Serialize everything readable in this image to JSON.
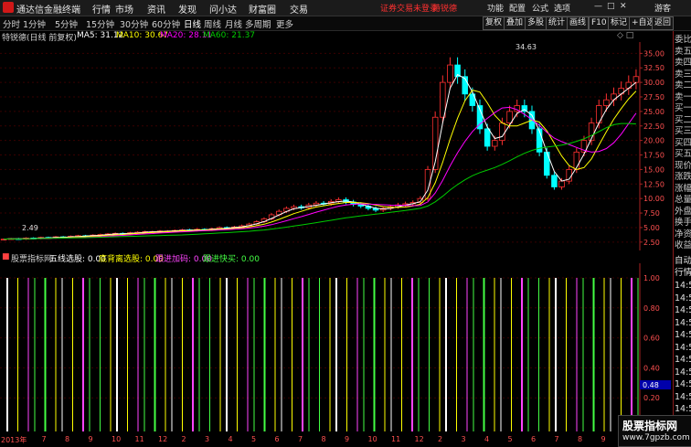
{
  "app": {
    "title": "通达信金融终端",
    "brand_color": "#d01818"
  },
  "menu": [
    "行情",
    "市场",
    "资讯",
    "发现",
    "问小达",
    "财富圈",
    "交易"
  ],
  "notice": {
    "text": "证券交易未登录",
    "stock": "特锐德"
  },
  "right_menu": [
    "功能",
    "配置",
    "公式",
    "选项",
    "游客"
  ],
  "periods": [
    "分时",
    "1分钟",
    "5分钟",
    "15分钟",
    "30分钟",
    "60分钟",
    "日线",
    "周线",
    "月线",
    "多周期",
    "更多"
  ],
  "active_period": "日线",
  "tool_buttons": [
    "复权",
    "叠加",
    "多股",
    "统计",
    "画线",
    "F10",
    "标记",
    "+自选",
    "返回"
  ],
  "legend": {
    "stock": "特锐德(日线 前复权)",
    "ma5": "MA5: 31.12",
    "ma10": "MA10: 30.67",
    "ma20": "MA20: 28.11",
    "ma60": "MA60: 21.37",
    "colors": {
      "ma5": "#ffffff",
      "ma10": "#ffff00",
      "ma20": "#ff00ff",
      "ma60": "#00cc00"
    }
  },
  "price_axis": [
    "35.00",
    "32.50",
    "30.00",
    "27.50",
    "25.00",
    "22.50",
    "20.00",
    "17.50",
    "15.00",
    "12.50",
    "10.00",
    "7.50",
    "5.00",
    "2.50"
  ],
  "annotations": {
    "high": "34.63",
    "low": "2.49"
  },
  "sub_header": {
    "site": "股票指标网",
    "s1": "五线选股: 0.00",
    "s2": "底背离选股: 0.00",
    "s3": "跟进加码: 0.00",
    "s4": "跟进快买: 0.00",
    "colors": {
      "s1": "#ffffff",
      "s2": "#ffff00",
      "s3": "#ff44ff",
      "s4": "#44ff44"
    }
  },
  "sub_axis": [
    "1.00",
    "0.80",
    "0.60",
    "0.40",
    "0.20"
  ],
  "sub_value": "0.48",
  "x_axis": [
    "2013年",
    "7",
    "8",
    "9",
    "10",
    "11",
    "12",
    "2",
    "3",
    "4",
    "5",
    "6",
    "7",
    "8",
    "9",
    "10",
    "11",
    "12",
    "2",
    "3",
    "4",
    "5",
    "6",
    "7",
    "8",
    "9",
    "10",
    "11"
  ],
  "right_panel": {
    "labels": [
      "委比",
      "卖五",
      "卖四",
      "卖三",
      "卖二",
      "卖一",
      "买一",
      "买二",
      "买三",
      "买四",
      "买五",
      "现价",
      "涨跌",
      "涨幅",
      "总量",
      "外盘",
      "换手",
      "净资",
      "收益"
    ],
    "lower": [
      "自动",
      "行情"
    ],
    "times": [
      "14:5",
      "14:5",
      "14:5",
      "14:5",
      "14:5",
      "14:5",
      "14:5",
      "14:5",
      "14:5",
      "14:5",
      "14:5"
    ],
    "top_value": "300"
  },
  "watermark": {
    "line1": "股票指标网",
    "line2": "www.7gpzb.com"
  },
  "window_buttons": [
    "—",
    "□",
    "✕"
  ],
  "chart_data": {
    "type": "candlestick",
    "price_range": [
      2.0,
      36.0
    ],
    "close_series": [
      3.0,
      3.1,
      3.0,
      3.2,
      3.1,
      3.3,
      3.2,
      3.4,
      3.3,
      3.5,
      3.6,
      3.5,
      3.7,
      3.8,
      3.9,
      4.0,
      3.9,
      4.1,
      4.2,
      4.3,
      4.3,
      4.4,
      4.4,
      4.5,
      4.6,
      4.5,
      4.7,
      4.6,
      4.8,
      5.0,
      4.9,
      5.1,
      5.3,
      5.6,
      6.0,
      6.5,
      7.2,
      7.8,
      8.3,
      8.6,
      8.4,
      8.9,
      9.2,
      9.1,
      9.5,
      9.8,
      9.4,
      9.0,
      8.7,
      8.3,
      8.0,
      8.3,
      8.6,
      8.9,
      9.1,
      9.3,
      10.0,
      15.0,
      24.0,
      30.0,
      33.0,
      31.0,
      28.0,
      26.0,
      22.0,
      19.0,
      20.0,
      23.0,
      25.0,
      26.0,
      25.0,
      22.0,
      18.0,
      14.0,
      12.0,
      13.0,
      15.0,
      18.0,
      20.0,
      23.0,
      26.0,
      27.0,
      28.0,
      29.0,
      30.0,
      31.0
    ],
    "subchart_bars": {
      "colors": {
        "s1": "#ffffff",
        "s2": "#ffff00",
        "s3": "#ff44ff",
        "s4": "#44ff44"
      },
      "values": [
        1,
        1,
        1,
        1,
        1,
        1,
        1,
        1,
        1,
        1,
        1,
        1,
        1,
        1,
        1,
        1,
        1,
        1,
        1,
        1,
        1,
        1,
        1,
        1,
        1,
        1,
        1,
        1,
        1,
        1,
        1,
        1,
        1,
        1,
        1,
        1,
        1,
        1,
        1,
        1,
        1,
        1,
        1,
        1,
        1,
        1,
        1,
        1,
        1,
        1,
        1,
        1,
        1,
        1,
        1,
        1,
        1,
        1,
        1,
        1,
        1,
        1,
        1,
        1,
        1,
        1,
        1,
        1,
        1,
        1
      ]
    }
  }
}
